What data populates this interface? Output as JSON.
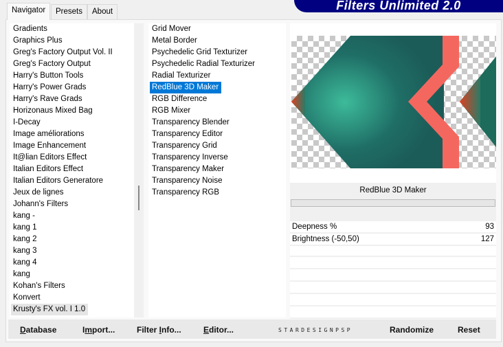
{
  "tabs": [
    {
      "label": "Navigator",
      "active": true
    },
    {
      "label": "Presets"
    },
    {
      "label": "About"
    }
  ],
  "banner": "Filters Unlimited 2.0",
  "categories": [
    "Gradients",
    "Graphics Plus",
    "Greg's Factory Output Vol. II",
    "Greg's Factory Output",
    "Harry's Button Tools",
    "Harry's Power Grads",
    "Harry's Rave Grads",
    "Horizonaus Mixed Bag",
    "I-Decay",
    "Image améliorations",
    "Image Enhancement",
    "It@lian Editors Effect",
    "Italian Editors Effect",
    "Italian Editors Generatore",
    "Jeux de lignes",
    "Johann's Filters",
    "kang -",
    "kang 1",
    "kang 2",
    "kang 3",
    "kang 4",
    "kang",
    "Kohan's Filters",
    "Konvert",
    "Krusty's FX vol. I 1.0"
  ],
  "highlighted_category": "Krusty's FX vol. I 1.0",
  "filters": [
    "Grid Mover",
    "Metal Border",
    "Psychedelic Grid Texturizer",
    "Psychedelic Radial Texturizer",
    "Radial Texturizer",
    "RedBlue 3D Maker",
    "RGB Difference",
    "RGB Mixer",
    "Transparency Blender",
    "Transparency Editor",
    "Transparency Grid",
    "Transparency Inverse",
    "Transparency Maker",
    "Transparency Noise",
    "Transparency RGB"
  ],
  "selected_filter": "RedBlue 3D Maker",
  "filter_title": "RedBlue 3D Maker",
  "params": [
    {
      "label": "Deepness %",
      "value": "93"
    },
    {
      "label": "Brightness (-50,50)",
      "value": "127"
    }
  ],
  "buttons": {
    "database": {
      "u": "D",
      "rest": "atabase"
    },
    "import": {
      "pre": "I",
      "u": "m",
      "rest": "port..."
    },
    "filter_info": {
      "pre": "Filter ",
      "u": "I",
      "rest": "nfo..."
    },
    "editor": {
      "u": "E",
      "rest": "ditor..."
    },
    "randomize": "Randomize",
    "reset": "Reset"
  },
  "watermark": "STARDESIGNPSP",
  "colors": {
    "selection": "#0078d7",
    "banner": "#000080",
    "teal": "#2a8a7a",
    "coral": "#f4675f"
  }
}
